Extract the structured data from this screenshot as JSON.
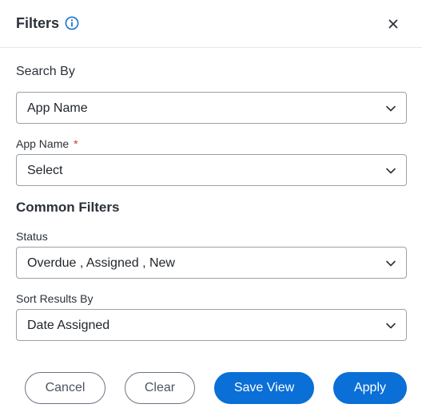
{
  "header": {
    "title": "Filters"
  },
  "search": {
    "label": "Search By",
    "value": "App Name"
  },
  "app_name": {
    "label": "App Name",
    "required_mark": "*",
    "value": "Select"
  },
  "common": {
    "heading": "Common Filters"
  },
  "status": {
    "label": "Status",
    "value": "Overdue , Assigned , New"
  },
  "sort": {
    "label": "Sort Results By",
    "value": "Date Assigned"
  },
  "buttons": {
    "cancel": "Cancel",
    "clear": "Clear",
    "save_view": "Save View",
    "apply": "Apply"
  },
  "colors": {
    "primary": "#0a6fd6",
    "required": "#d0342c",
    "info_icon": "#1a73c9"
  },
  "icons": {
    "info": "info-icon",
    "close": "close-icon",
    "dropdown": "chevron-down-icon"
  }
}
